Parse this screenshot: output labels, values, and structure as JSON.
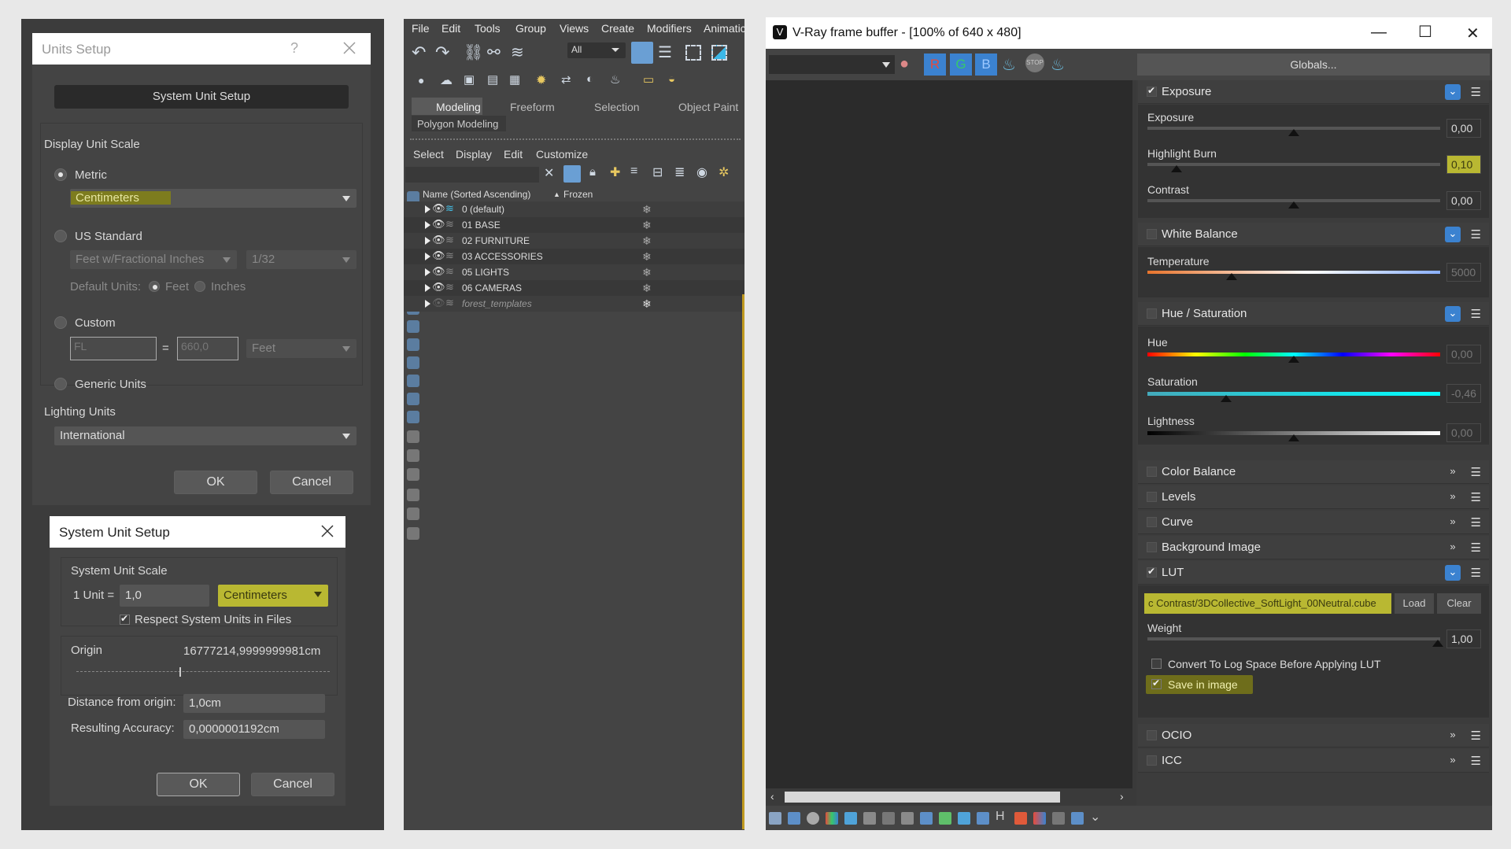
{
  "units_setup": {
    "title": "Units Setup",
    "help": "?",
    "system_unit_setup_button": "System Unit Setup",
    "display_unit_scale_label": "Display Unit Scale",
    "metric_label": "Metric",
    "metric_value": "Centimeters",
    "us_standard_label": "US Standard",
    "us_unit_value": "Feet w/Fractional Inches",
    "us_fraction_value": "1/32",
    "default_units_label": "Default Units:",
    "feet_label": "Feet",
    "inches_label": "Inches",
    "custom_label": "Custom",
    "custom_name_value": "FL",
    "custom_equals": "=",
    "custom_amount_value": "660,0",
    "custom_unit_value": "Feet",
    "generic_units_label": "Generic Units",
    "lighting_units_label": "Lighting Units",
    "lighting_units_value": "International",
    "ok_label": "OK",
    "cancel_label": "Cancel"
  },
  "system_unit_setup": {
    "title": "System Unit Setup",
    "scale_label": "System Unit Scale",
    "one_unit_label": "1 Unit =",
    "unit_amount": "1,0",
    "unit_value": "Centimeters",
    "respect_label": "Respect System Units in Files",
    "origin_label": "Origin",
    "origin_value": "16777214,9999999981cm",
    "distance_label": "Distance from origin:",
    "distance_value": "1,0cm",
    "accuracy_label": "Resulting Accuracy:",
    "accuracy_value": "0,0000001192cm",
    "ok_label": "OK",
    "cancel_label": "Cancel"
  },
  "max": {
    "menu": [
      "File",
      "Edit",
      "Tools",
      "Group",
      "Views",
      "Create",
      "Modifiers",
      "Animatic"
    ],
    "filter_value": "All",
    "ribbon_tabs": [
      "Modeling",
      "Freeform",
      "Selection",
      "Object Paint"
    ],
    "ribbon_sub": "Polygon Modeling",
    "explorer_menu": [
      "Select",
      "Display",
      "Edit",
      "Customize"
    ],
    "col_name": "Name (Sorted Ascending)",
    "col_frozen": "Frozen",
    "layers": [
      "0 (default)",
      "01 BASE",
      "02 FURNITURE",
      "03 ACCESSORIES",
      "05 LIGHTS",
      "06 CAMERAS",
      "forest_templates"
    ]
  },
  "vfb": {
    "title": "V-Ray frame buffer - [100% of 640 x 480]",
    "globals": "Globals...",
    "channel_r": "R",
    "channel_g": "G",
    "channel_b": "B",
    "exposure": {
      "title": "Exposure",
      "enabled": true,
      "exposure_label": "Exposure",
      "exposure_value": "0,00",
      "highlight_label": "Highlight Burn",
      "highlight_value": "0,10",
      "contrast_label": "Contrast",
      "contrast_value": "0,00"
    },
    "white_balance": {
      "title": "White Balance",
      "enabled": false,
      "temperature_label": "Temperature",
      "temperature_value": "5000"
    },
    "hue_saturation": {
      "title": "Hue / Saturation",
      "enabled": false,
      "hue_label": "Hue",
      "hue_value": "0,00",
      "saturation_label": "Saturation",
      "saturation_value": "-0,46",
      "lightness_label": "Lightness",
      "lightness_value": "0,00"
    },
    "collapsed": [
      "Color Balance",
      "Levels",
      "Curve",
      "Background Image"
    ],
    "lut": {
      "title": "LUT",
      "enabled": true,
      "file": "c Contrast/3DCollective_SoftLight_00Neutral.cube",
      "load": "Load",
      "clear": "Clear",
      "weight_label": "Weight",
      "weight_value": "1,00",
      "log_label": "Convert To Log Space Before Applying LUT",
      "save_label": "Save in image"
    },
    "tail": [
      "OCIO",
      "ICC"
    ],
    "status_letter": "H"
  },
  "colors": {
    "highlight": "#b9b832",
    "accent_blue": "#3b82d0"
  }
}
